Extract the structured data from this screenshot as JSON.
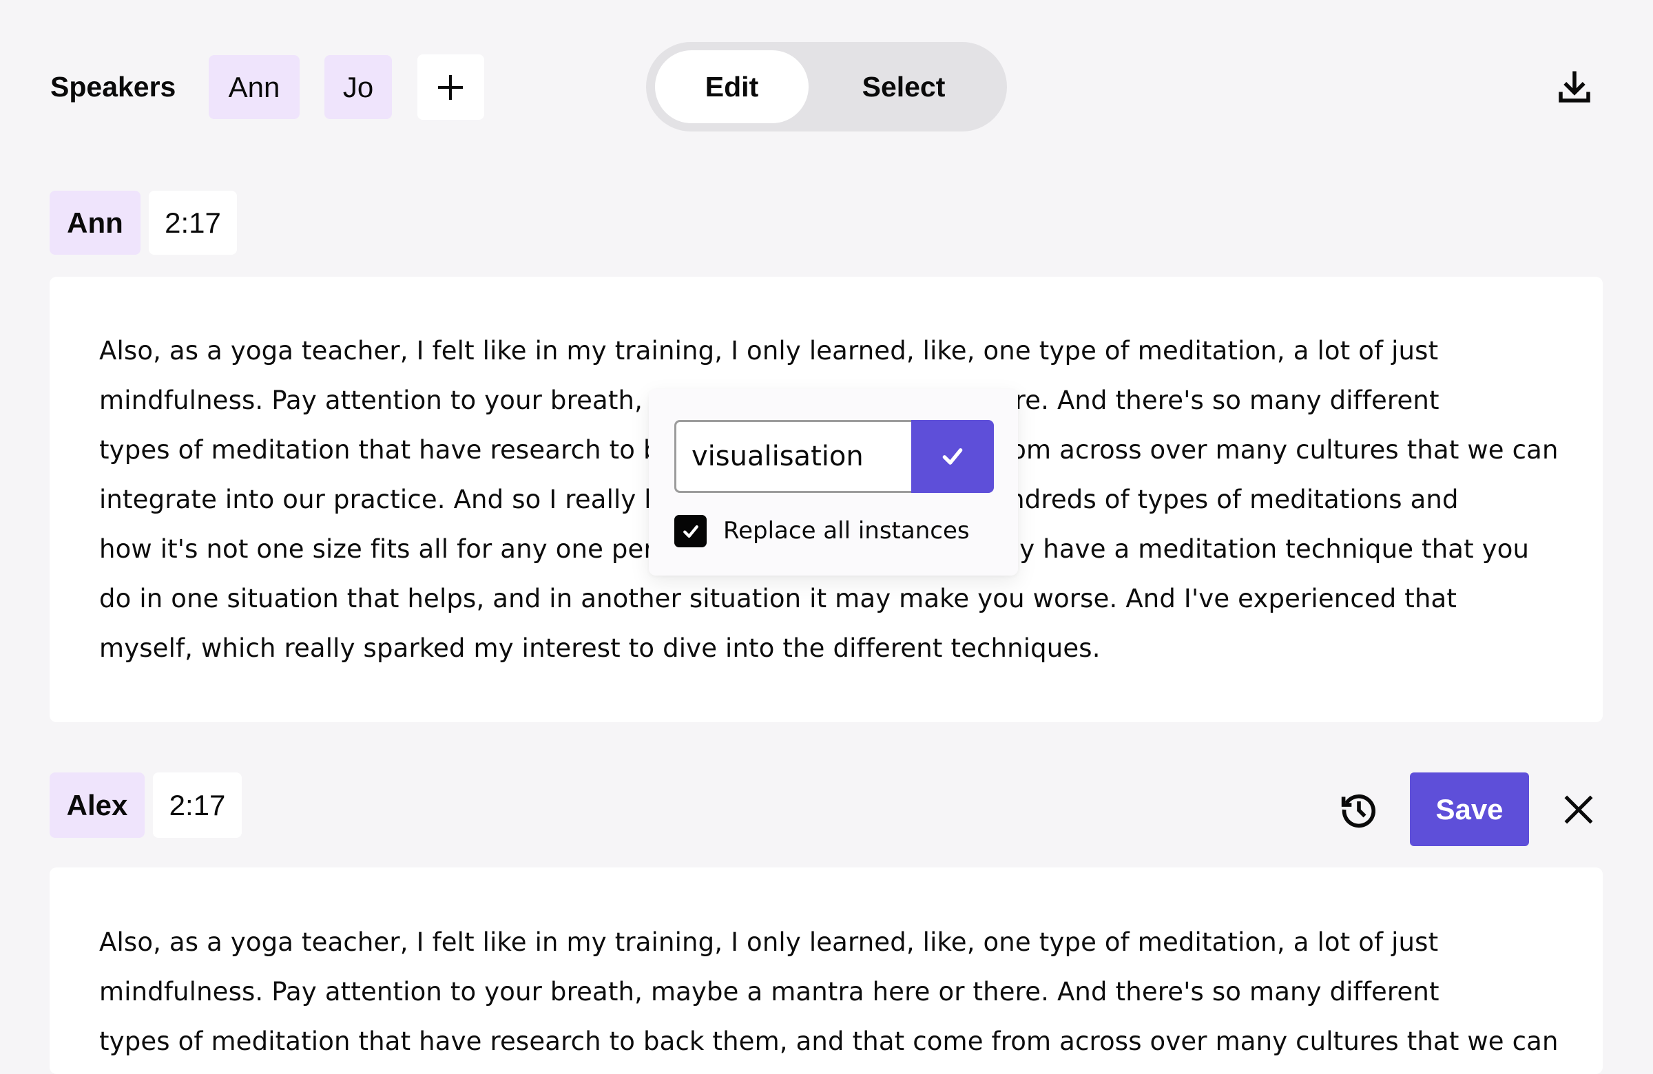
{
  "toolbar": {
    "speakers_label": "Speakers",
    "speakers": [
      {
        "name": "Ann"
      },
      {
        "name": "Jo"
      }
    ],
    "add_speaker_icon": "plus-icon",
    "mode_toggle": {
      "options": [
        "Edit",
        "Select"
      ],
      "selected": "Edit"
    },
    "download_icon": "download-icon"
  },
  "segments": [
    {
      "speaker": "Ann",
      "time": "2:17",
      "lines": [
        "Also, as a yoga teacher, I felt like in my training,  I only learned, like, one type of meditation, a lot of just",
        "mindfulness. Pay attention to your breath, maybe a mantra here or there. And there's so many different",
        "types of meditation that have research to back them, and that come from across over many cultures that we can",
        "integrate into our practice. And so I really became interested in the hundreds of types of meditations and",
        "how it's not one size fits all for any one person. And sometimes you may have a meditation technique that you",
        "do in one situation that helps, and in another situation it may make you worse. And I've experienced that",
        "myself, which really sparked my interest to dive into the different techniques."
      ]
    },
    {
      "speaker": "Alex",
      "time": "2:17",
      "lines": [
        "Also, as a yoga teacher, I felt like in my training,  I only learned, like, one type of meditation, a lot of just",
        "mindfulness. Pay attention to your breath, maybe a mantra here or there. And there's so many different",
        "types of meditation that have research to back them, and that come from across over many cultures that we can"
      ],
      "actions": {
        "history_icon": "history-icon",
        "save_label": "Save",
        "close_icon": "close-icon"
      }
    }
  ],
  "replace_popup": {
    "input_value": "visualisation",
    "confirm_icon": "check-icon",
    "replace_all_checked": true,
    "replace_all_label": "Replace all instances"
  },
  "colors": {
    "accent": "#5e4fd9",
    "speaker_chip": "#efe4fc",
    "background": "#f6f5f7",
    "toggle_track": "#e3e2e5"
  }
}
